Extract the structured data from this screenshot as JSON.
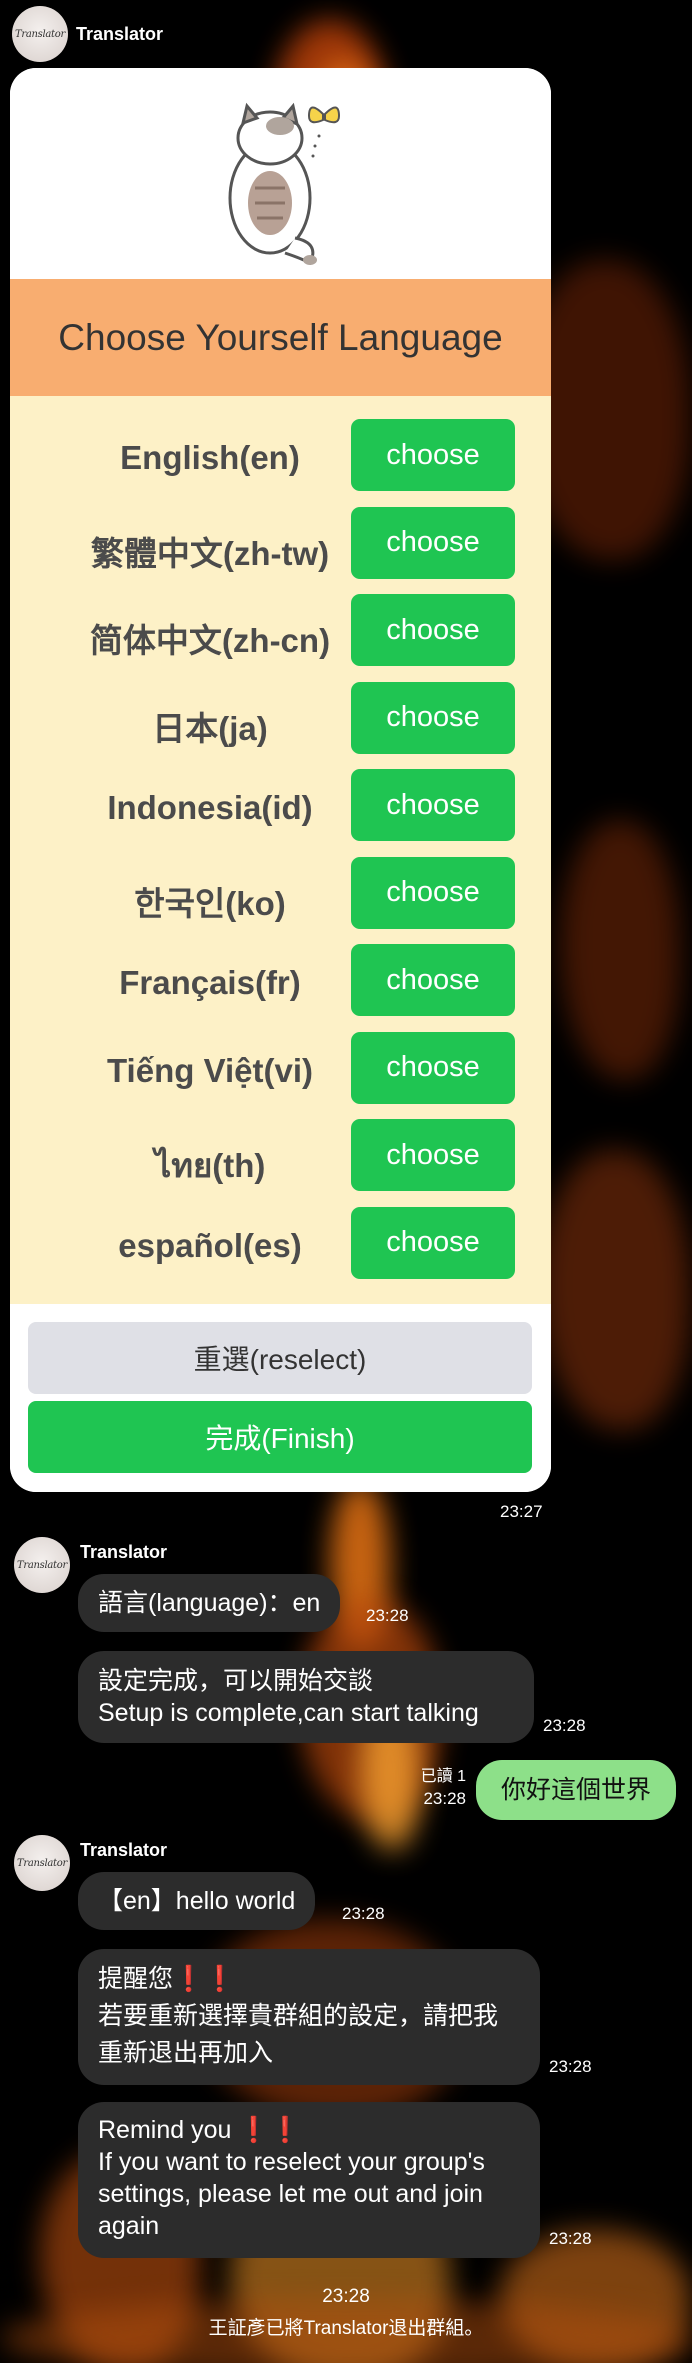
{
  "app": {
    "bot_name": "Translator",
    "avatar_text": "Translator"
  },
  "card": {
    "header": "Choose Yourself Language",
    "choose_label": "choose",
    "languages": [
      "English(en)",
      "繁體中文(zh-tw)",
      "简体中文(zh-cn)",
      "日本(ja)",
      "Indonesia(id)",
      "한국인(ko)",
      "Français(fr)",
      "Tiếng Việt(vi)",
      "ไทย(th)",
      "español(es)"
    ],
    "reselect_label": "重選(reselect)",
    "finish_label": "完成(Finish)"
  },
  "messages": {
    "card_time": "23:27",
    "m1": {
      "sender": "Translator",
      "text": "語言(language)：en",
      "time": "23:28"
    },
    "m2": {
      "line1": "設定完成，可以開始交談",
      "line2": "Setup is complete,can start talking",
      "time": "23:28"
    },
    "m3": {
      "read": "已讀 1",
      "time": "23:28",
      "text": "你好這個世界"
    },
    "m4": {
      "sender": "Translator",
      "text": "【en】hello world",
      "time": "23:28"
    },
    "m5": {
      "line1": "提醒您❗❗",
      "line2": "若要重新選擇貴群組的設定，請把我",
      "line3": "重新退出再加入",
      "time": "23:28"
    },
    "m6": {
      "line1": "Remind you ❗❗",
      "line2": "If you want to reselect your group's",
      "line3": "settings, please let me out and join",
      "line4": "again",
      "time": "23:28"
    },
    "system": {
      "time": "23:28",
      "text": "王証彥已將Translator退出群組。"
    }
  },
  "colors": {
    "green": "#1fc552",
    "header": "#f8ad70",
    "lang_bg": "#fdf1c7",
    "bubble": "#2c2c2c",
    "own_bubble": "#8de089"
  },
  "icons": [
    "bot-avatar",
    "cat-illustration",
    "butterfly-icon"
  ]
}
